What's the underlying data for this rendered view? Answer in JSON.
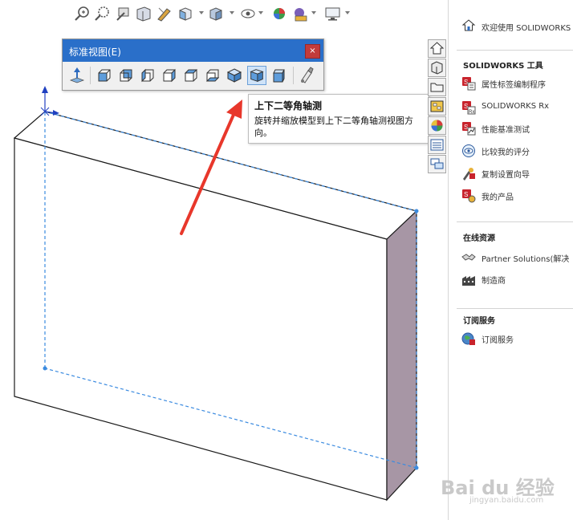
{
  "hud": {
    "icons": [
      "zoom-to-fit-icon",
      "zoom-to-area-icon",
      "previous-view-icon",
      "section-view-icon",
      "dynamic-annotation-icon",
      "view-orientation-icon",
      "display-style-icon",
      "hide-show-items-icon",
      "edit-appearance-icon",
      "apply-scene-icon",
      "view-settings-icon"
    ]
  },
  "standard_views": {
    "title": "标准视图(E)",
    "close_label": "×",
    "buttons": [
      "normal-to",
      "front",
      "back",
      "left",
      "right",
      "top",
      "bottom",
      "isometric",
      "trimetric",
      "dimetric",
      "view-selector"
    ],
    "selected": "dimetric"
  },
  "tooltip": {
    "title": "上下二等角轴测",
    "body": "旋转并缩放模型到上下二等角轴测视图方向。"
  },
  "task_pane": {
    "welcome": "欢迎使用  SOLIDWORKS",
    "tools_title": "SOLIDWORKS 工具",
    "tools": [
      {
        "icon": "property-tab-builder-icon",
        "label": "属性标签编制程序"
      },
      {
        "icon": "solidworks-rx-icon",
        "label": "SOLIDWORKS Rx"
      },
      {
        "icon": "performance-benchmark-icon",
        "label": "性能基准测试"
      },
      {
        "icon": "compare-score-icon",
        "label": "比较我的评分"
      },
      {
        "icon": "copy-settings-wizard-icon",
        "label": "复制设置向导"
      },
      {
        "icon": "my-products-icon",
        "label": "我的产品"
      }
    ],
    "online_title": "在线资源",
    "online": [
      {
        "icon": "partner-handshake-icon",
        "label": "Partner Solutions(解决"
      },
      {
        "icon": "manufacturer-factory-icon",
        "label": "制造商"
      }
    ],
    "subscription_title": "订阅服务",
    "subscription": [
      {
        "icon": "subscription-globe-icon",
        "label": "订阅服务"
      }
    ]
  },
  "watermark": {
    "brand": "Bai du 经验",
    "url": "jingyan.baidu.com"
  },
  "colors": {
    "titlebar": "#2a6fc9",
    "arrow": "#e8372b",
    "side_face": "#a796a5",
    "dashed": "#3b8be0"
  }
}
